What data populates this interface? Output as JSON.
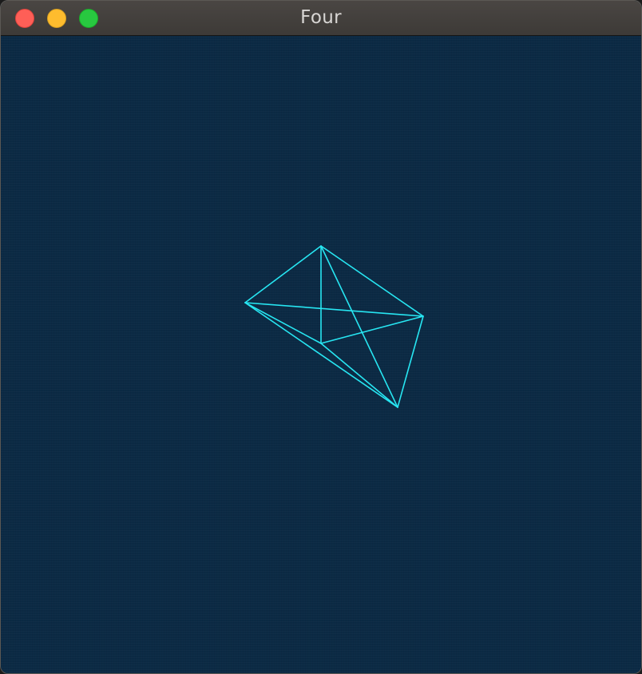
{
  "window": {
    "title": "Four"
  },
  "scene": {
    "description_label": "",
    "wireframe_color": "#27e6f2",
    "background_color": "#0b2a44"
  }
}
